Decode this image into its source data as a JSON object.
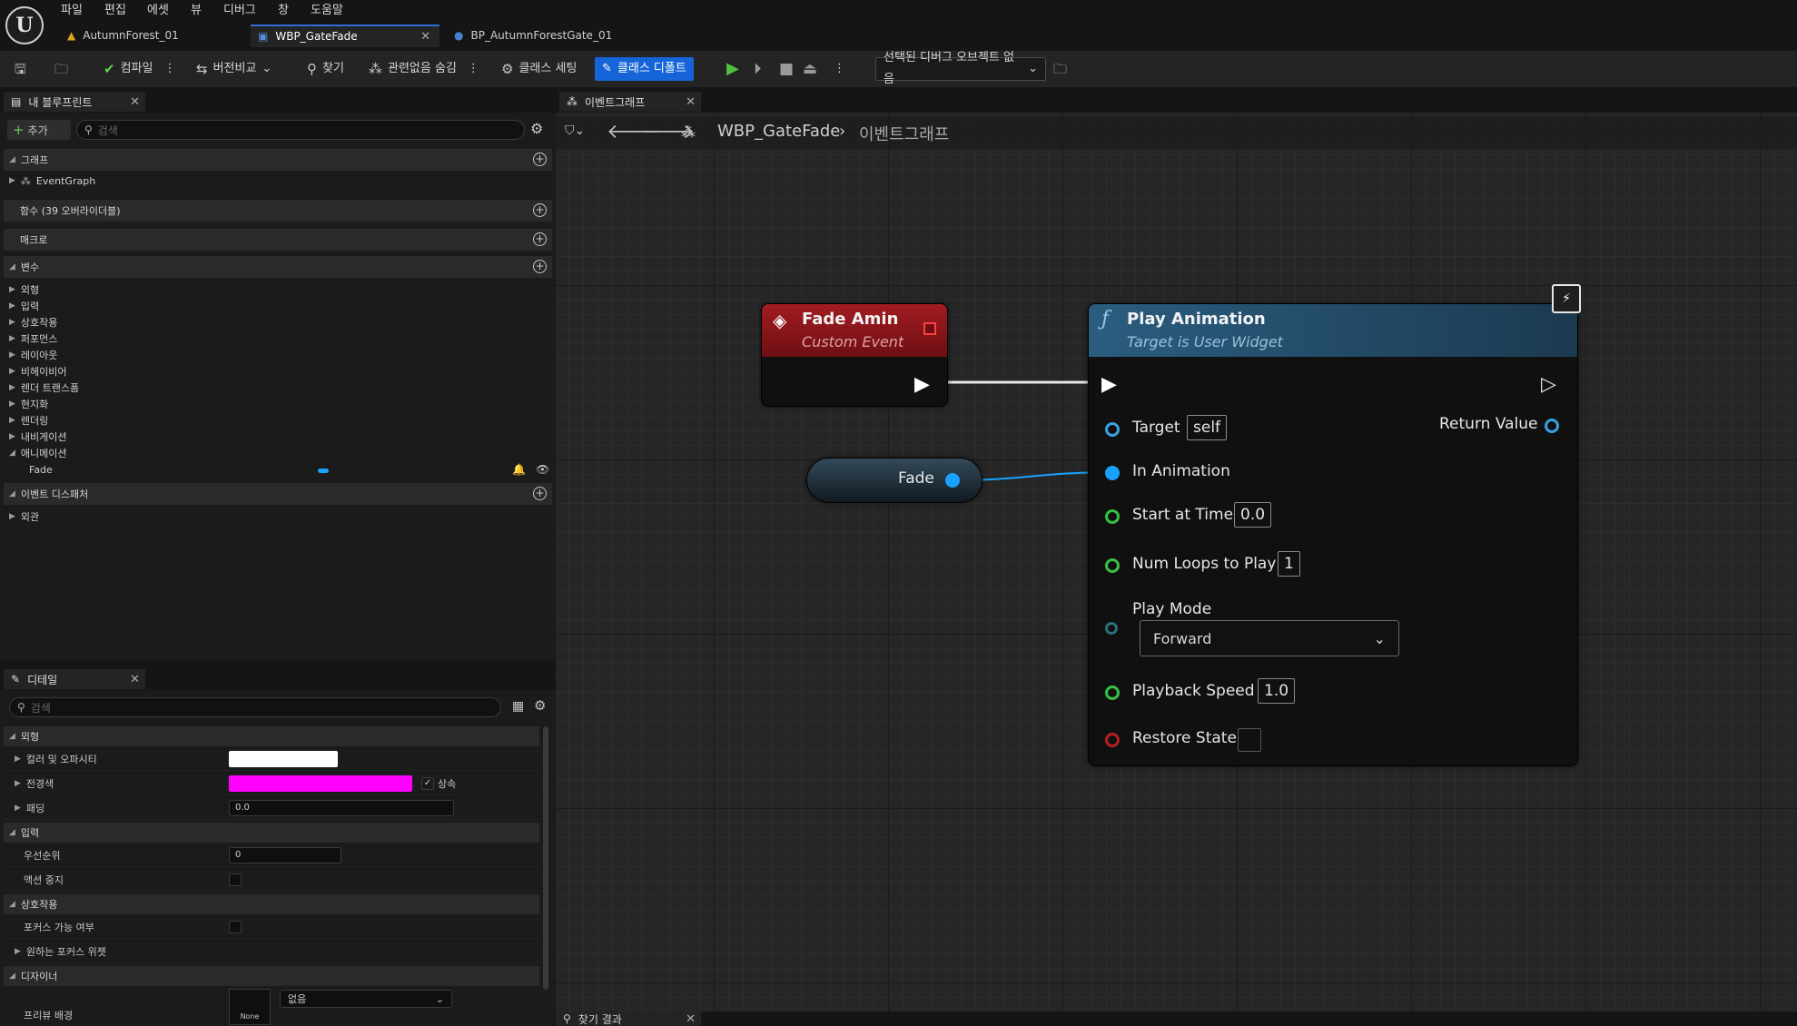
{
  "menu": [
    "파일",
    "편집",
    "에셋",
    "뷰",
    "디버그",
    "창",
    "도움말"
  ],
  "doc_tabs": [
    {
      "label": "AutumnForest_01"
    },
    {
      "label": "WBP_GateFade"
    },
    {
      "label": "BP_AutumnForestGate_01"
    }
  ],
  "toolbar": {
    "compile": "컴파일",
    "diff": "버전비교",
    "find": "찾기",
    "hide_unrelated": "관련없음 숨김",
    "class_settings": "클래스 세팅",
    "class_defaults": "클래스 디폴트",
    "debug_object": "선택된 디버그 오브젝트 없음"
  },
  "my_blueprint": {
    "tab": "내 블루프린트",
    "add": "추가",
    "search_placeholder": "검색",
    "sections": {
      "graphs": "그래프",
      "event_graph": "EventGraph",
      "functions": "함수 (39 오버라이더블)",
      "macros": "매크로",
      "variables": "변수",
      "dispatchers": "이벤트 디스패처",
      "dispatcher_appearance": "외관"
    },
    "variable_categories": [
      "외형",
      "입력",
      "상호작용",
      "퍼포먼스",
      "레이아웃",
      "비헤이비어",
      "렌더 트랜스폼",
      "현지화",
      "렌더링",
      "내비게이션",
      "애니메이션"
    ],
    "animation_var": "Fade"
  },
  "details": {
    "tab": "디테일",
    "search_placeholder": "검색",
    "sec_appearance": "외형",
    "color_opacity": "컬러 및 오파시티",
    "foreground": "전경색",
    "inherit": "상속",
    "padding": "패딩",
    "padding_value": "0.0",
    "sec_input": "입력",
    "priority": "우선순위",
    "priority_value": "0",
    "stop_action": "액션 중지",
    "sec_interaction": "상호작용",
    "focusable": "포커스 가능 여부",
    "desired_focus": "원하는 포커스 위젯",
    "sec_designer": "디자이너",
    "preview_bg": "프리뷰 배경",
    "preview_value": "없음",
    "none_label": "None"
  },
  "graph": {
    "tab": "이벤트그래프",
    "breadcrumb_root": "WBP_GateFade",
    "breadcrumb_leaf": "이벤트그래프",
    "fade_event": {
      "title": "Fade Amin",
      "subtitle": "Custom Event"
    },
    "fade_var": "Fade",
    "play_anim": {
      "title": "Play Animation",
      "subtitle": "Target is User Widget",
      "target": "Target",
      "target_value": "self",
      "return_value": "Return Value",
      "in_animation": "In Animation",
      "start_at_time": "Start at Time",
      "start_at_time_value": "0.0",
      "num_loops": "Num Loops to Play",
      "num_loops_value": "1",
      "play_mode": "Play Mode",
      "play_mode_value": "Forward",
      "playback_speed": "Playback Speed",
      "playback_speed_value": "1.0",
      "restore_state": "Restore State"
    }
  },
  "bottom_tab": "찾기 결과",
  "colors": {
    "accent": "#1565d8",
    "event_red": "#a11c22",
    "func_blue": "#2a5d80",
    "pin_blue": "#1aa0ff",
    "pin_green": "#38c042"
  }
}
